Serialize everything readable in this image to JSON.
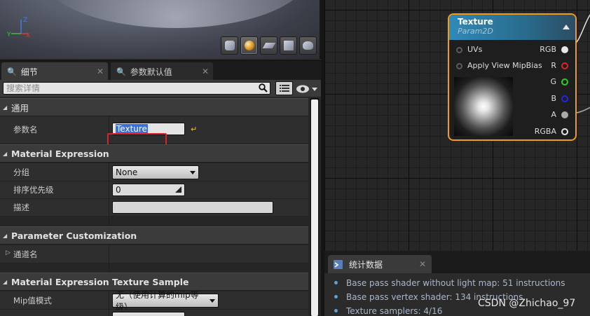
{
  "viewport": {
    "axis_z": "Z",
    "axis_y": "Y",
    "axis_x": "X",
    "preview_buttons": [
      "cylinder",
      "sphere",
      "plane",
      "cube",
      "teapot"
    ]
  },
  "details_tabs": [
    {
      "label": "细节",
      "icon": "magnifier-icon",
      "active": true
    },
    {
      "label": "参数默认值",
      "icon": "magnifier-icon",
      "active": false
    }
  ],
  "search": {
    "placeholder": "搜索详情"
  },
  "categories": {
    "general": "通用",
    "material_expression": "Material Expression",
    "parameter_customization": "Parameter Customization",
    "texture_sample": "Material Expression Texture Sample"
  },
  "rows": {
    "param_name": {
      "label": "参数名",
      "value": "Texture"
    },
    "group": {
      "label": "分组",
      "value": "None"
    },
    "sort_priority": {
      "label": "排序优先级",
      "value": "0"
    },
    "description": {
      "label": "描述",
      "value": ""
    },
    "channel_names": {
      "label": "通道名"
    },
    "mip_mode": {
      "label": "Mip值模式",
      "value": "无（使用计算的mip等级）"
    }
  },
  "node": {
    "title": "Texture",
    "subtitle": "Param2D",
    "inputs": [
      "UVs",
      "Apply View MipBias"
    ],
    "outputs": [
      {
        "label": "RGB",
        "color": "#e8e8e8",
        "filled": true
      },
      {
        "label": "R",
        "color": "#e02424",
        "filled": false
      },
      {
        "label": "G",
        "color": "#24d024",
        "filled": false
      },
      {
        "label": "B",
        "color": "#2424e8",
        "filled": false
      },
      {
        "label": "A",
        "color": "#aaaaaa",
        "filled": true
      },
      {
        "label": "RGBA",
        "color": "#e8e8e8",
        "filled": false
      }
    ],
    "border_color": "#f29d19"
  },
  "stats": {
    "tab_label": "统计数据",
    "lines": [
      "Base pass shader without light map: 51 instructions",
      "Base pass vertex shader: 134 instructions",
      "Texture samplers: 4/16"
    ]
  },
  "watermark": "CSDN @Zhichao_97"
}
